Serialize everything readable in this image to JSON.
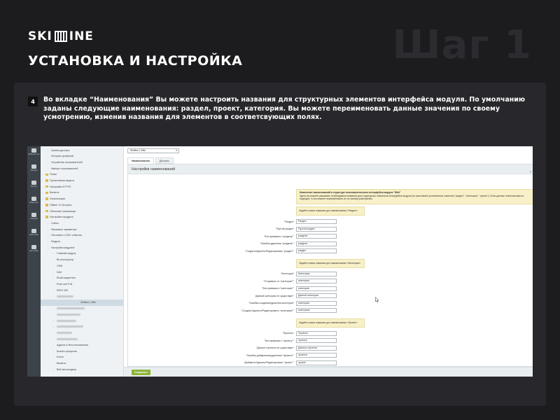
{
  "brand": {
    "logo_left": "SKI",
    "logo_right": "INE"
  },
  "page_title": "УСТАНОВКА И НАСТРОЙКА",
  "step_label": "Шаг 1",
  "instruction": {
    "number": "4",
    "text": "Во вкладке “Наименования” Вы можете настроить названия для структурных элементов интерфейса модуля. По умолчанию заданы следующие наименования: раздел, проект, категория. Вы можете переименовать данные значения по своему усмотрению, изменив названия для элементов в соответсвующих полях."
  },
  "screenshot": {
    "iconbar": [
      {
        "icon": "desktop-icon",
        "label": "Рабочий стол"
      },
      {
        "icon": "cart-icon",
        "label": "Магазин"
      },
      {
        "icon": "content-icon",
        "label": "Контент"
      },
      {
        "icon": "marketing-icon",
        "label": "Маркетинг"
      },
      {
        "icon": "services-icon",
        "label": "Сервисы"
      },
      {
        "icon": "analytics-icon",
        "label": "Аналитика"
      },
      {
        "icon": "settings-icon",
        "label": "Настройки"
      }
    ],
    "tree": [
      {
        "label": "Уровни доступа",
        "indent": 2,
        "folder": false
      },
      {
        "label": "История профилей",
        "indent": 2,
        "folder": false
      },
      {
        "label": "Устройства пользователей",
        "indent": 2,
        "folder": false
      },
      {
        "label": "Импорт пользователей",
        "indent": 2,
        "folder": false
      },
      {
        "label": "Поиск",
        "indent": 1,
        "folder": true
      },
      {
        "label": "Проактивная защита",
        "indent": 1,
        "folder": true
      },
      {
        "label": "Настройки HTTPS",
        "indent": 1,
        "folder": true
      },
      {
        "label": "Валюты",
        "indent": 1,
        "folder": true
      },
      {
        "label": "Локализация",
        "indent": 1,
        "folder": true
      },
      {
        "label": "Обмен 1С-Битрикс",
        "indent": 1,
        "folder": true
      },
      {
        "label": "Облачные хранилища",
        "indent": 1,
        "folder": true
      },
      {
        "label": "Настройки продукта",
        "indent": 1,
        "folder": true
      },
      {
        "label": "Сайты",
        "indent": 2,
        "folder": false
      },
      {
        "label": "Языковые параметры",
        "indent": 2,
        "folder": false
      },
      {
        "label": "Почтовые и СМС события",
        "indent": 2,
        "folder": false
      },
      {
        "label": "Модули",
        "indent": 2,
        "folder": false
      },
      {
        "label": "Настройки модулей",
        "indent": 2,
        "folder": false
      },
      {
        "label": "Главный модуль",
        "indent": 3,
        "folder": false
      },
      {
        "label": "Bl-конструктор",
        "indent": 3,
        "folder": false
      },
      {
        "label": "CRM",
        "indent": 3,
        "folder": false
      },
      {
        "label": "DAV",
        "indent": 3,
        "folder": false
      },
      {
        "label": "Email-маркетинг",
        "indent": 3,
        "folder": false
      },
      {
        "label": "Push and Pull",
        "indent": 3,
        "folder": false
      },
      {
        "label": "REST API",
        "indent": 3,
        "folder": false
      },
      {
        "label": "",
        "indent": 3,
        "folder": false,
        "blurred": 24
      },
      {
        "label": "Skillline | Wiki",
        "indent": 3,
        "folder": false,
        "selected": true
      },
      {
        "label": "",
        "indent": 3,
        "folder": false,
        "blurred": 40
      },
      {
        "label": "",
        "indent": 3,
        "folder": false,
        "blurred": 34
      },
      {
        "label": "",
        "indent": 3,
        "folder": false,
        "blurred": 28
      },
      {
        "label": "",
        "indent": 3,
        "folder": false,
        "blurred": 38
      },
      {
        "label": "",
        "indent": 3,
        "folder": false,
        "blurred": 22
      },
      {
        "label": "",
        "indent": 3,
        "folder": false,
        "blurred": 30
      },
      {
        "label": "Адреса и Местоположения",
        "indent": 3,
        "folder": false
      },
      {
        "label": "Бизнес-процессы",
        "indent": 3,
        "folder": false
      },
      {
        "label": "Блоги",
        "indent": 3,
        "folder": false
      },
      {
        "label": "Валюты",
        "indent": 3,
        "folder": false
      },
      {
        "label": "Веб-мессенджер",
        "indent": 3,
        "folder": false
      }
    ],
    "select_value": "Skillline | Wiki",
    "tabs": [
      "Наименования",
      "Доступы"
    ],
    "panel_title": "Настройки наименований",
    "note_title": "Изменение наименований в структуре пользовательского интерфейса модуля \"Wiki\"",
    "note_text": "Здесь вы можете указывать необходимые названия для структурных элементов интерфейса модуля (по умолчанию установлены значения \"раздел\", \"категория\", \"проект\"). Если данные значения вам не подходят, то вы можете переименовать их по своему усмотрению.",
    "groups": [
      {
        "heading": "Задайте новые названия для наименования «Раздел»",
        "fields": [
          {
            "label": "\"Раздел\"",
            "value": "Раздел"
          },
          {
            "label": "\"Пустой раздел\"",
            "value": "Пустой раздел"
          },
          {
            "label": "\"Без привязки к \"разделу\"\"",
            "value": "раздела"
          },
          {
            "label": "\"Ошибка удаления \"раздела\"\"",
            "value": "раздела"
          },
          {
            "label": "\"Создать/Удалить/Редактировать \"раздел\"\"",
            "value": "раздел"
          }
        ]
      },
      {
        "heading": "Задайте новые названия для наименования «Категория»",
        "fields": [
          {
            "label": "\"Категории\"",
            "value": "Категории"
          },
          {
            "label": "\"Отправить от \"категории\"\"",
            "value": "категории"
          },
          {
            "label": "\"Без привязки к \"категории\"\"",
            "value": "категории"
          },
          {
            "label": "\"Данной категории не существует\"",
            "value": "Данной категории"
          },
          {
            "label": "\"Ошибка создания/удаления категории\"",
            "value": "категории"
          },
          {
            "label": "\"Создать/Удалить/Редактировать \"категорию\"\"",
            "value": "категорию"
          }
        ]
      },
      {
        "heading": "Задайте новые названия для наименования «Проект»",
        "fields": [
          {
            "label": "\"Проекты\"",
            "value": "Проекты"
          },
          {
            "label": "\"Без привязки к \"проекту\"\"",
            "value": "проекту"
          },
          {
            "label": "\"Данного проекта не существует\"",
            "value": "Данного проекта"
          },
          {
            "label": "\"Ошибка добавления/удаления \"проекта\"\"",
            "value": "проекта"
          },
          {
            "label": "\"Добавить/Удалить/Редактировать \"проект\"\"",
            "value": "проект"
          }
        ]
      }
    ],
    "save_label": "Сохранить"
  }
}
